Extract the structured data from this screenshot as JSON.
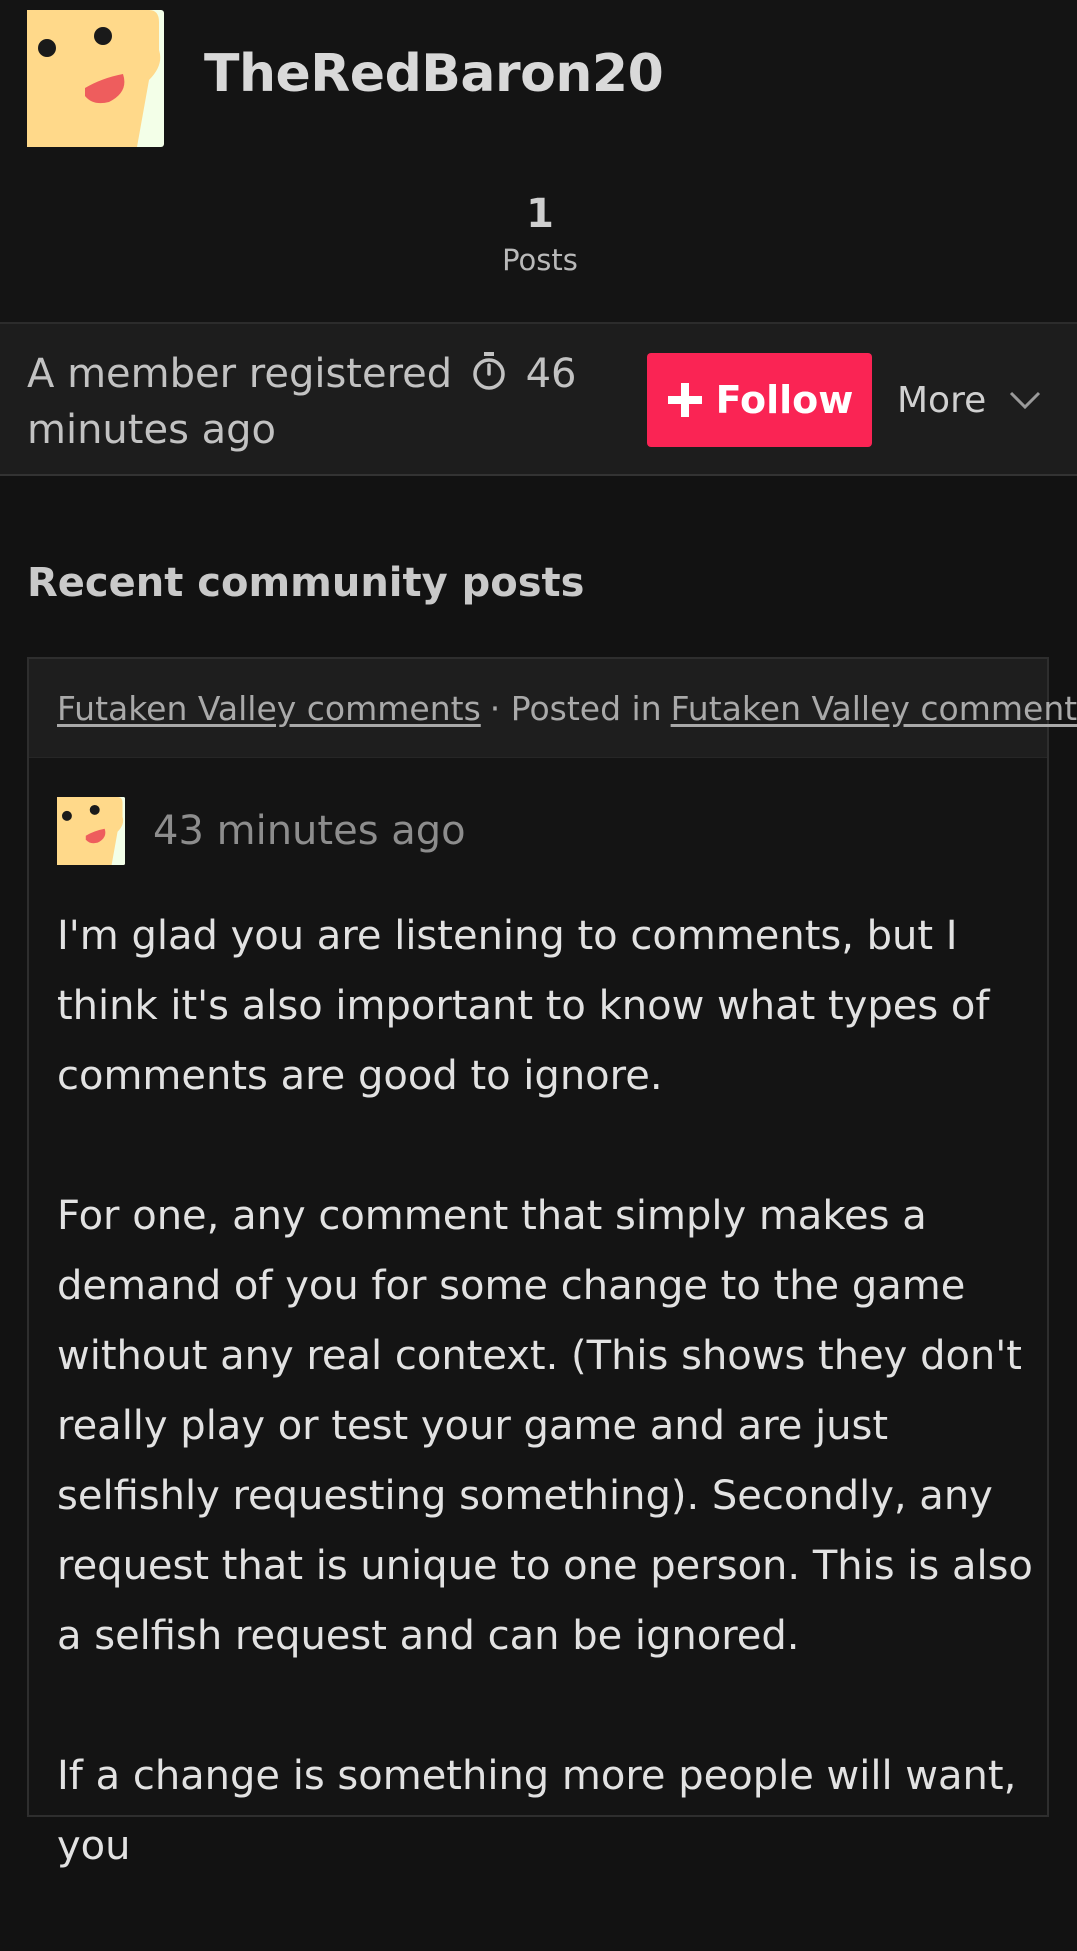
{
  "profile": {
    "username": "TheRedBaron20",
    "stats": {
      "count": "1",
      "label": "Posts"
    },
    "registered_prefix": "A member registered",
    "registered_time": "46 minutes ago",
    "follow_label": "Follow",
    "more_label": "More"
  },
  "section": {
    "title": "Recent community posts"
  },
  "post": {
    "topic_link": "Futaken Valley comments",
    "posted_in_text": "· Posted in",
    "community_link": "Futaken Valley comments",
    "time": "43 minutes ago",
    "paragraphs": [
      "I'm glad you are listening to comments, but I think it's also important to know what types of comments are good to ignore.",
      "For one, any comment that simply makes a demand of you for some change to the game without any real context. (This shows they don't really play or test your game and are just selfishly requesting something). Secondly, any request that is unique to one person. This is also a selfish request and can be ignored.",
      "If a change is something more people will want, you"
    ]
  },
  "colors": {
    "background": "#121212",
    "accent": "#fa2454",
    "avatar_fill": "#ffd98a",
    "avatar_bg": "#f3ffe8",
    "avatar_mouth": "#ee5d5d"
  },
  "icons": [
    "avatar-icon",
    "timer-icon",
    "plus-icon",
    "chevron-down-icon"
  ]
}
